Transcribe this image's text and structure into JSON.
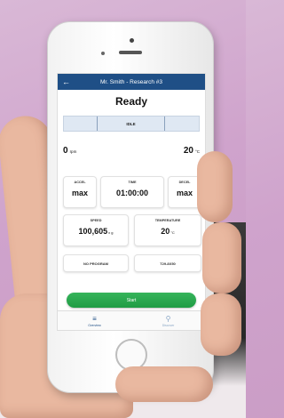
{
  "header": {
    "back_icon": "arrow-left-icon",
    "title": "Mr. Smith - Research #3"
  },
  "status": "Ready",
  "state_bar": {
    "label": "IDLE"
  },
  "readouts": {
    "speed_value": "0",
    "speed_unit": "rpm",
    "temp_value": "20",
    "temp_unit": "°C"
  },
  "tiles": {
    "accel_label": "ACCEL",
    "accel_value": "max",
    "time_label": "TIME",
    "time_value": "01:00:00",
    "decel_label": "DECEL",
    "decel_value": "max",
    "speed_label": "SPEED",
    "speed_value": "100,605",
    "speed_unit": "x g",
    "temperature_label": "TEMPERATURE",
    "temperature_value": "20",
    "temperature_unit": "°C",
    "program_label": "NO PROGRAM",
    "rotor_label": "T29-8X50"
  },
  "start_button": "Start",
  "tabs": [
    {
      "label": "Overview",
      "icon": "menu-icon"
    },
    {
      "label": "Discover",
      "icon": "search-icon"
    }
  ],
  "colors": {
    "topbar": "#1f4f86",
    "start": "#2aa84f"
  }
}
